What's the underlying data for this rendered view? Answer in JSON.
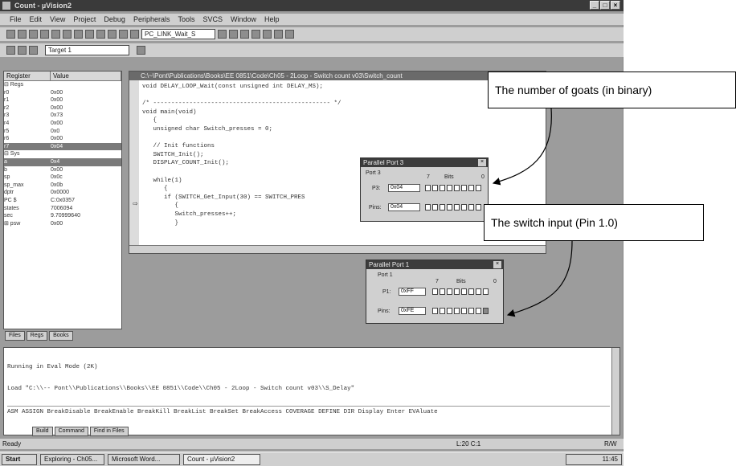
{
  "window": {
    "title": "Count - µVision2",
    "min": "_",
    "max": "□",
    "close": "×"
  },
  "menu": [
    "File",
    "Edit",
    "View",
    "Project",
    "Debug",
    "Peripherals",
    "Tools",
    "SVCS",
    "Window",
    "Help"
  ],
  "toolbar": {
    "target_combo": "PC_LINK_Wait_S",
    "target2_combo": "Target 1"
  },
  "registers": {
    "col_register": "Register",
    "col_value": "Value",
    "rows": [
      {
        "n": "⊟ Regs",
        "v": ""
      },
      {
        "n": "   r0",
        "v": "0x00"
      },
      {
        "n": "   r1",
        "v": "0x00"
      },
      {
        "n": "   r2",
        "v": "0x00"
      },
      {
        "n": "   r3",
        "v": "0x73"
      },
      {
        "n": "   r4",
        "v": "0x00"
      },
      {
        "n": "   r5",
        "v": "0x0"
      },
      {
        "n": "   r6",
        "v": "0x00"
      },
      {
        "n": "   r7",
        "v": "0x04",
        "sel": true
      },
      {
        "n": "⊟ Sys",
        "v": ""
      },
      {
        "n": "   a",
        "v": "0x4",
        "sel": true
      },
      {
        "n": "   b",
        "v": "0x00"
      },
      {
        "n": "   sp",
        "v": "0x0c"
      },
      {
        "n": "   sp_max",
        "v": "0x0b"
      },
      {
        "n": "   dptr",
        "v": "0x0000"
      },
      {
        "n": "   PC  $",
        "v": "C:0x0357"
      },
      {
        "n": "   states",
        "v": "7006094"
      },
      {
        "n": "   sec",
        "v": "9.70999640"
      },
      {
        "n": "⊞ psw",
        "v": "0x00"
      }
    ],
    "tabs": [
      "Files",
      "Regs",
      "Books"
    ]
  },
  "editor": {
    "title": "C:\\~\\Pont\\Publications\\Books\\EE 0851\\Code\\Ch05 - 2Loop - Switch count v03\\Switch_count",
    "lines": [
      "void DELAY_LOOP_Wait(const unsigned int DELAY_MS);",
      "",
      "/* ------------------------------------------------- */",
      "void main(void)",
      "   {",
      "   unsigned char Switch_presses = 0;",
      "",
      "   // Init functions",
      "   SWITCH_Init();",
      "   DISPLAY_COUNT_Init();",
      "",
      "   while(1)",
      "      {",
      "      if (SWITCH_Get_Input(30) == SWITCH_PRES",
      "         {",
      "         Switch_presses++;",
      "         }"
    ]
  },
  "port3": {
    "title": "Parallel Port 3",
    "group": "Port 3",
    "bits_label": "Bits",
    "bit7": "7",
    "bit0": "0",
    "p3_label": "P3:",
    "p3_val": "0x04",
    "pins_label": "Pins:",
    "pins_val": "0x04"
  },
  "port1": {
    "title": "Parallel Port 1",
    "group": "Port 1",
    "bits_label": "Bits",
    "bit7": "7",
    "bit0": "0",
    "p1_label": "P1:",
    "p1_val": "0xFF",
    "pins_label": "Pins:",
    "pins_val": "0xFE"
  },
  "output": {
    "lines": [
      "Running in Eval Mode (2K)",
      "Load \"C:\\\\-- Pont\\\\Publications\\\\Books\\\\EE 0851\\\\Code\\\\Ch05 - 2Loop - Switch count v03\\\\S_Delay\""
    ],
    "cmd": "ASM ASSIGN BreakDisable BreakEnable BreakKill BreakList BreakSet BreakAccess COVERAGE DEFINE DIR Display Enter EVAluate",
    "tabs": [
      "Build",
      "Command",
      "Find in Files"
    ]
  },
  "status": {
    "left": "Ready",
    "pos": "L:20 C:1",
    "mode": "R/W"
  },
  "taskbar": {
    "start": "Start",
    "items": [
      "Exploring - Ch05...",
      "Microsoft Word...",
      "Count - µVision2"
    ],
    "clock": "11:45"
  },
  "callouts": {
    "goats": "The number of goats (in binary)",
    "switch": "The switch input (Pin 1.0)"
  }
}
